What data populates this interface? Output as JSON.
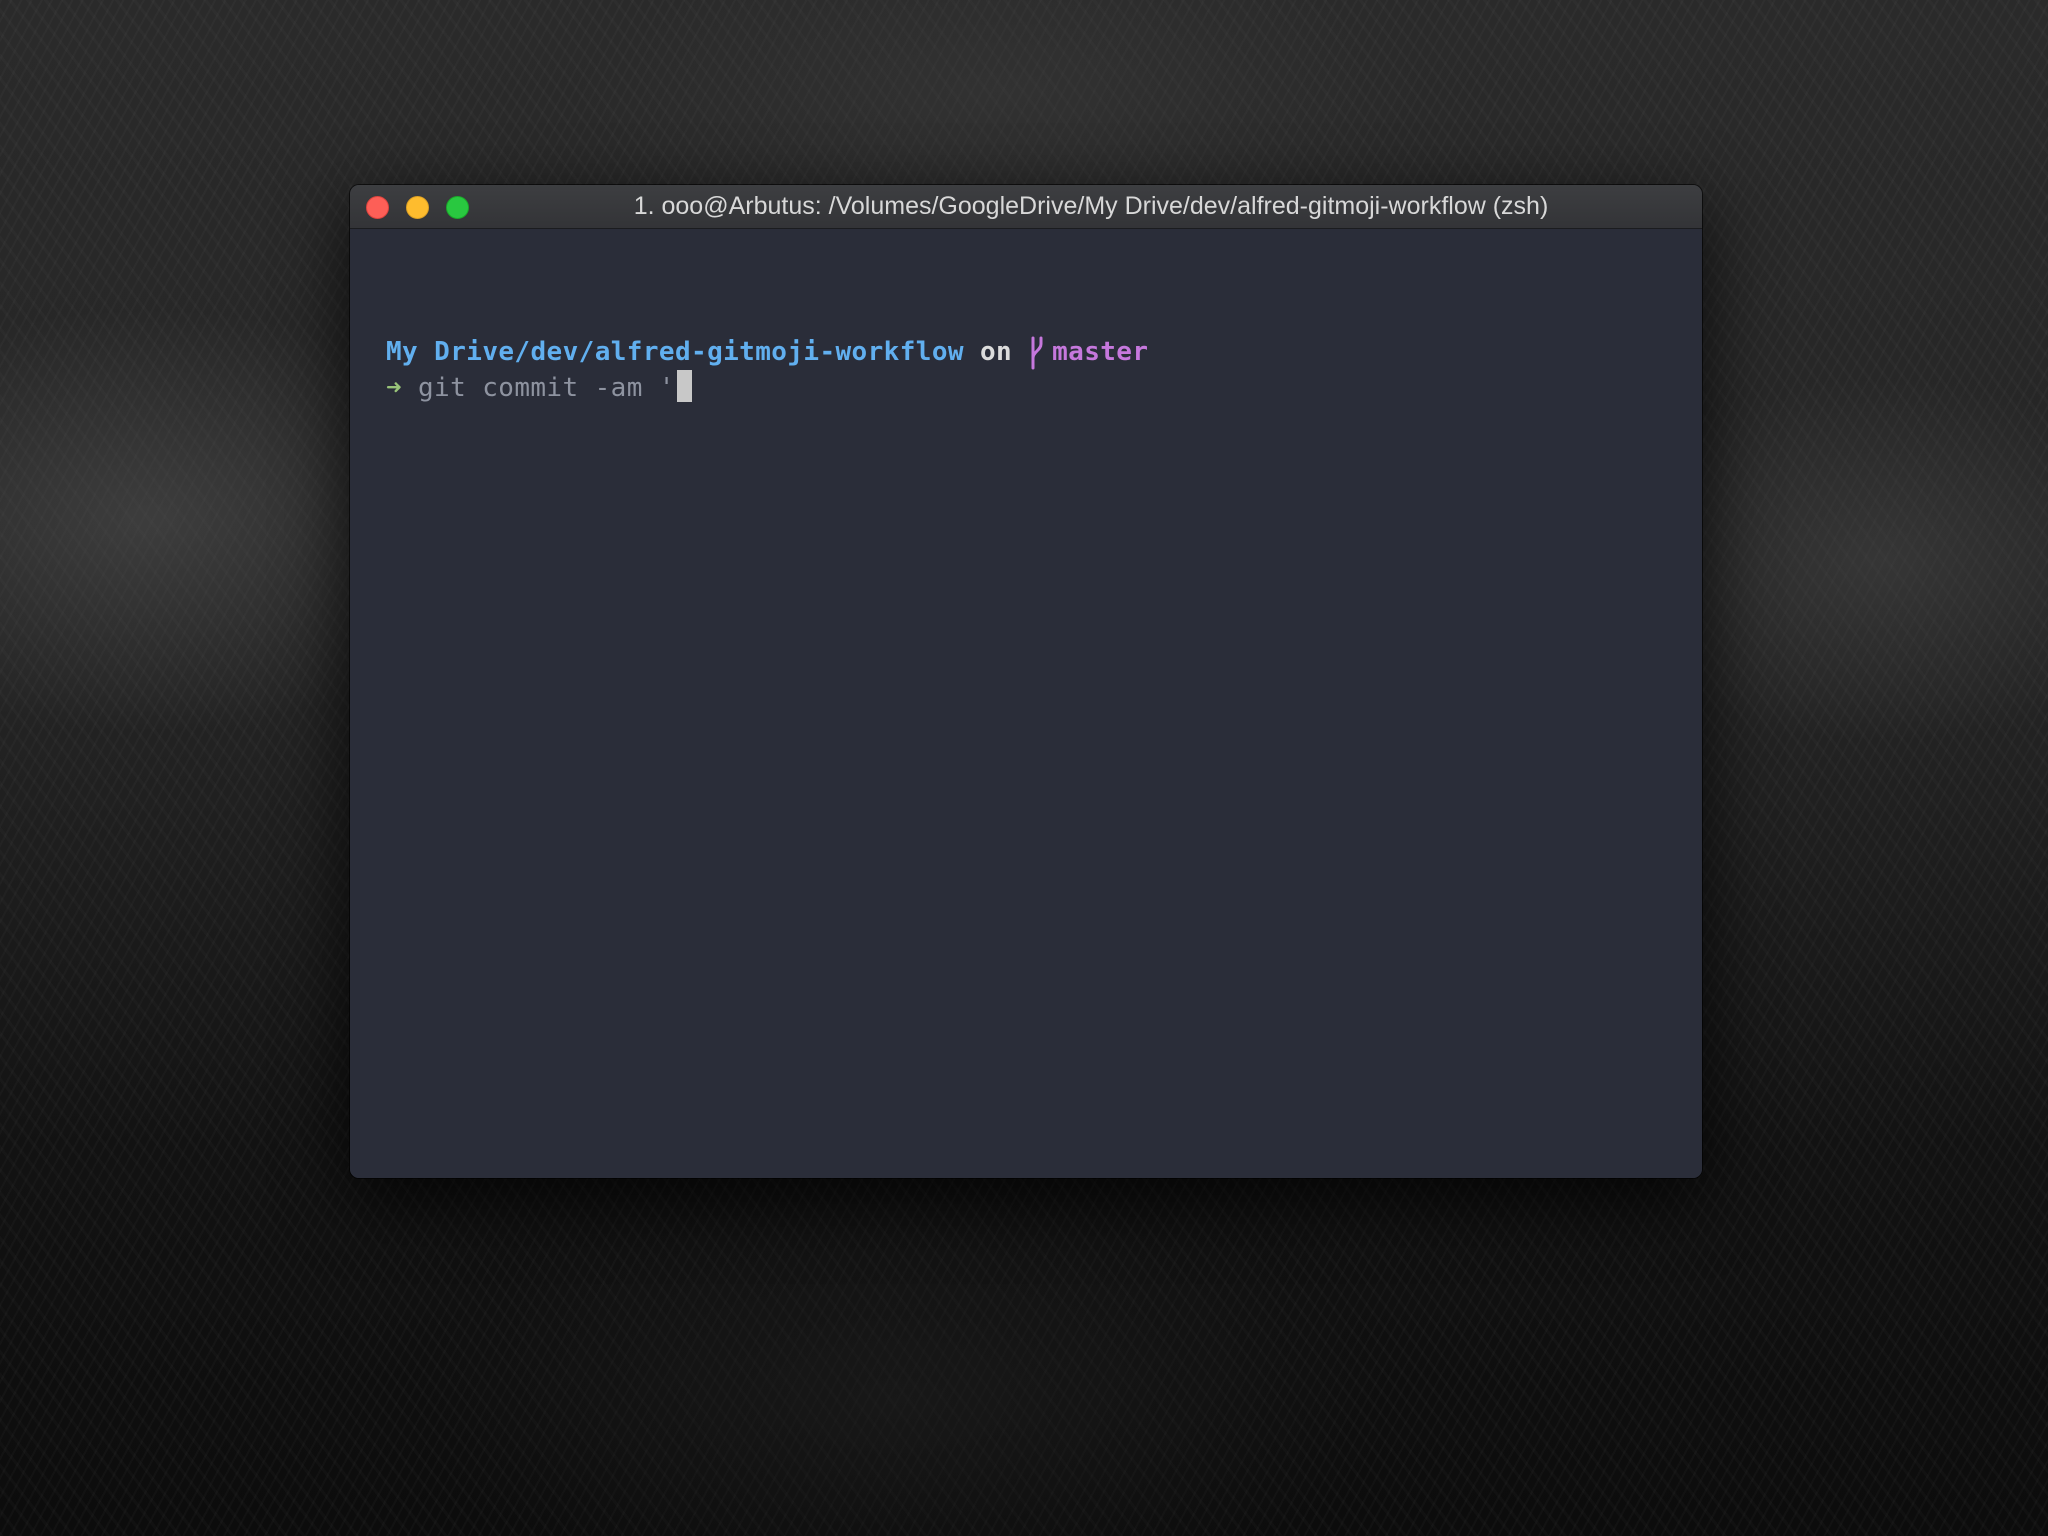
{
  "window": {
    "title": "1. ooo@Arbutus: /Volumes/GoogleDrive/My Drive/dev/alfred-gitmoji-workflow (zsh)",
    "traffic_lights": {
      "close_color": "#fd5f57",
      "minimize_color": "#febc2e",
      "zoom_color": "#29c840"
    }
  },
  "terminal": {
    "prompt": {
      "path": "My Drive/dev/alfred-gitmoji-workflow",
      "on_text": "on",
      "branch_icon": "git-branch-icon",
      "branch": "master"
    },
    "input": {
      "arrow": "➜",
      "command": "git commit -am '"
    },
    "colors": {
      "background": "#2a2d39",
      "path": "#61afef",
      "branch": "#c678dd",
      "arrow": "#98c379",
      "command": "#8e93a0"
    }
  }
}
